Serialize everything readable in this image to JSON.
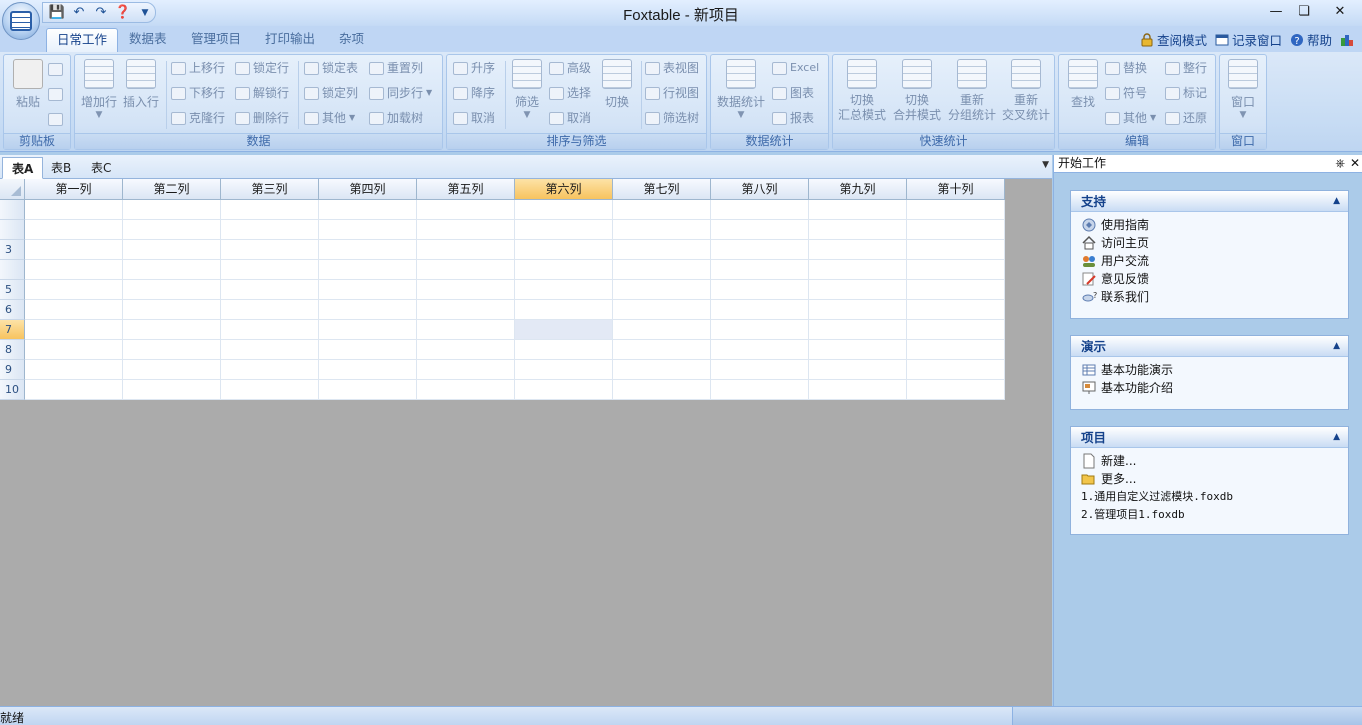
{
  "window": {
    "title": "Foxtable - 新项目"
  },
  "colors": {
    "accent": "#15428b",
    "ribbon_bg": "#c7dcf4",
    "selected_header": "#f7c35f",
    "workspace": "#ababab"
  },
  "ribbon_tabs": [
    "日常工作",
    "数据表",
    "管理项目",
    "打印输出",
    "杂项"
  ],
  "top_right": {
    "view_mode": "查阅模式",
    "record_window": "记录窗口",
    "help": "帮助"
  },
  "groups": {
    "clipboard": {
      "label": "剪贴板",
      "paste": "粘贴"
    },
    "data": {
      "label": "数据",
      "add_row": "增加行",
      "insert_row": "插入行",
      "move_up": "上移行",
      "move_down": "下移行",
      "clone_row": "克隆行",
      "lock_row": "锁定行",
      "unlock_row": "解锁行",
      "delete_row": "删除行",
      "lock_table": "锁定表",
      "lock_col": "锁定列",
      "other": "其他",
      "reset_col": "重置列",
      "sync_row": "同步行",
      "load_tree": "加载树"
    },
    "sort_filter": {
      "label": "排序与筛选",
      "asc": "升序",
      "desc": "降序",
      "cancel": "取消",
      "filter": "筛选",
      "advanced": "高级",
      "select": "选择",
      "cancel2": "取消",
      "switch": "切换",
      "table_view": "表视图",
      "row_view": "行视图",
      "filter_tree": "筛选树"
    },
    "data_stats": {
      "label": "数据统计",
      "stats": "数据统计",
      "excel": "Excel",
      "chart": "图表",
      "report": "报表"
    },
    "quick_stats": {
      "label": "快速统计",
      "summary_line1": "切换",
      "summary_line2": "汇总模式",
      "merge_line1": "切换",
      "merge_line2": "合并模式",
      "group_line1": "重新",
      "group_line2": "分组统计",
      "cross_line1": "重新",
      "cross_line2": "交叉统计"
    },
    "edit": {
      "label": "编辑",
      "find": "查找",
      "replace": "替换",
      "symbol": "符号",
      "other": "其他",
      "tidy": "整行",
      "mark": "标记",
      "restore": "还原"
    },
    "window_group": {
      "label": "窗口",
      "window": "窗口"
    }
  },
  "sheet_tabs": [
    "表A",
    "表B",
    "表C"
  ],
  "grid": {
    "columns": [
      "第一列",
      "第二列",
      "第三列",
      "第四列",
      "第五列",
      "第六列",
      "第七列",
      "第八列",
      "第九列",
      "第十列"
    ],
    "rows": [
      "",
      "",
      "3",
      "",
      "5",
      "6",
      "7",
      "8",
      "9",
      "10"
    ],
    "selected_column": "第六列",
    "selected_row": "7"
  },
  "task_pane": {
    "title": "开始工作",
    "panels": {
      "support": {
        "title": "支持",
        "items": [
          "使用指南",
          "访问主页",
          "用户交流",
          "意见反馈",
          "联系我们"
        ]
      },
      "demo": {
        "title": "演示",
        "items": [
          "基本功能演示",
          "基本功能介绍"
        ]
      },
      "project": {
        "title": "项目",
        "items": [
          "新建...",
          "更多..."
        ],
        "recent": [
          "1.通用自定义过滤模块.foxdb",
          "2.管理项目1.foxdb"
        ]
      }
    }
  },
  "status": {
    "text": "就绪"
  }
}
